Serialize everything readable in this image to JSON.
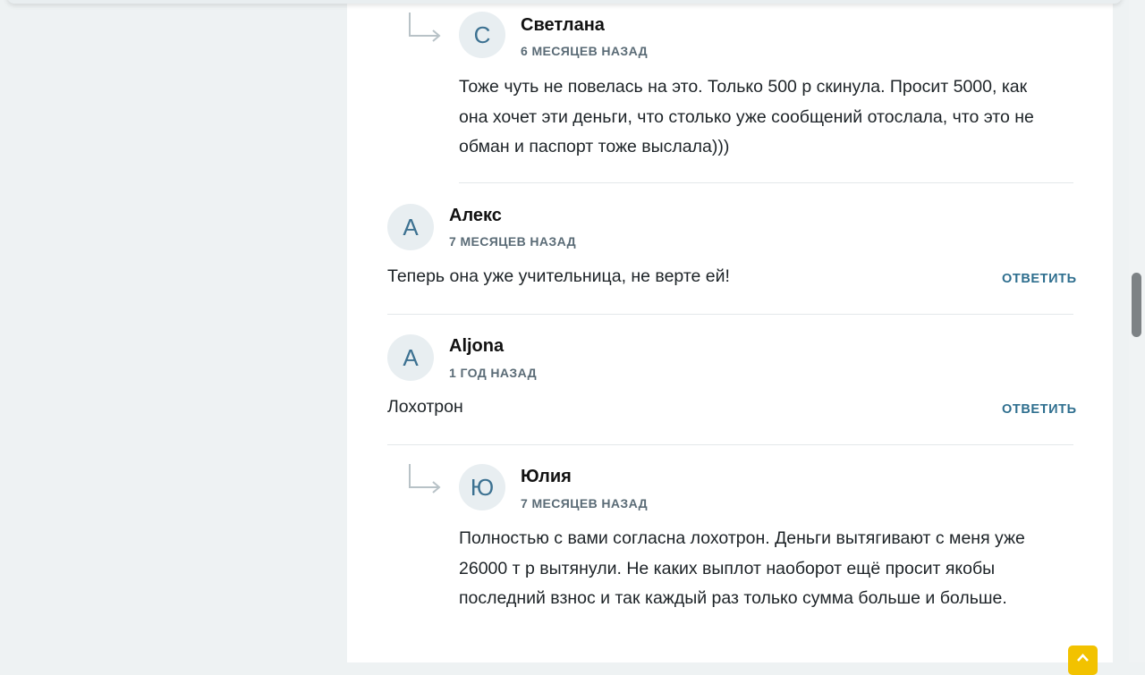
{
  "comments": [
    {
      "initial": "С",
      "author": "Светлана",
      "date": "6 МЕСЯЦЕВ НАЗАД",
      "text": "Тоже чуть не повелась на это. Только 500 р скинула. Просит 5000, как она хочет эти деньги, что столько уже сообщений отослала, что это не обман и паспорт тоже выслала)))",
      "is_reply": true
    },
    {
      "initial": "А",
      "author": "Алекс",
      "date": "7 МЕСЯЦЕВ НАЗАД",
      "text": "Теперь она уже учительница, не верте ей!",
      "reply_label": "ОТВЕТИТЬ",
      "is_reply": false
    },
    {
      "initial": "A",
      "author": "Aljona",
      "date": "1 ГОД НАЗАД",
      "text": "Лохотрон",
      "reply_label": "ОТВЕТИТЬ",
      "is_reply": false
    },
    {
      "initial": "Ю",
      "author": "Юлия",
      "date": "7 МЕСЯЦЕВ НАЗАД",
      "text": "Полностью с вами согласна лохотрон. Деньги вытягивают с меня уже 26000 т р вытянули. Не каких выплот наоборот ещё просит якобы последний взнос и так каждый раз только сумма больше и больше.",
      "is_reply": true
    }
  ],
  "icons": {
    "reply_arrow": "reply-arrow-icon",
    "scroll_top": "chevron-up-icon"
  },
  "colors": {
    "accent": "#2f6f8f",
    "avatar_bg": "#e8eef1",
    "scroll_top_button": "#f2c200"
  }
}
